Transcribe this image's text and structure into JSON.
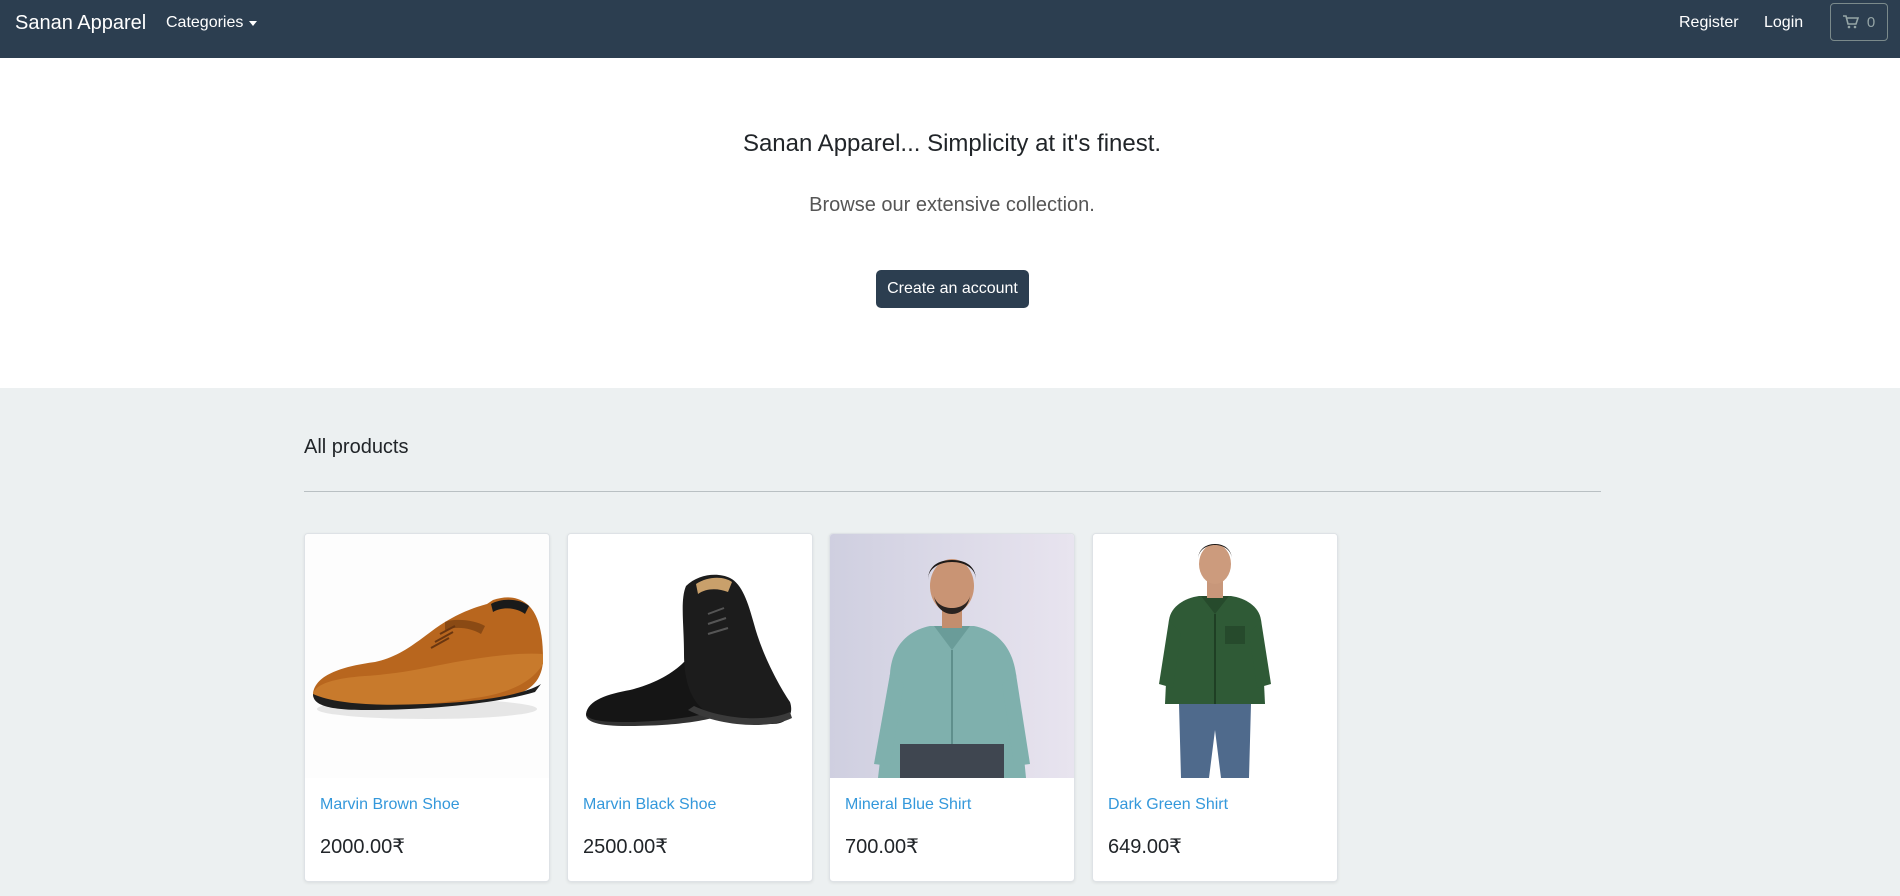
{
  "navbar": {
    "brand": "Sanan Apparel",
    "categories_label": "Categories",
    "register_label": "Register",
    "login_label": "Login",
    "cart_count": "0"
  },
  "hero": {
    "title": "Sanan Apparel... Simplicity at it's finest.",
    "subtitle": "Browse our extensive collection.",
    "button_label": "Create an account"
  },
  "products": {
    "heading": "All products",
    "items": [
      {
        "name": "Marvin Brown Shoe",
        "price": "2000.00₹"
      },
      {
        "name": "Marvin Black Shoe",
        "price": "2500.00₹"
      },
      {
        "name": "Mineral Blue Shirt",
        "price": "700.00₹"
      },
      {
        "name": "Dark Green Shirt",
        "price": "649.00₹"
      }
    ]
  },
  "colors": {
    "navbar_bg": "#2c3e50",
    "link": "#3498db",
    "page_bg": "#ecf0f1"
  }
}
